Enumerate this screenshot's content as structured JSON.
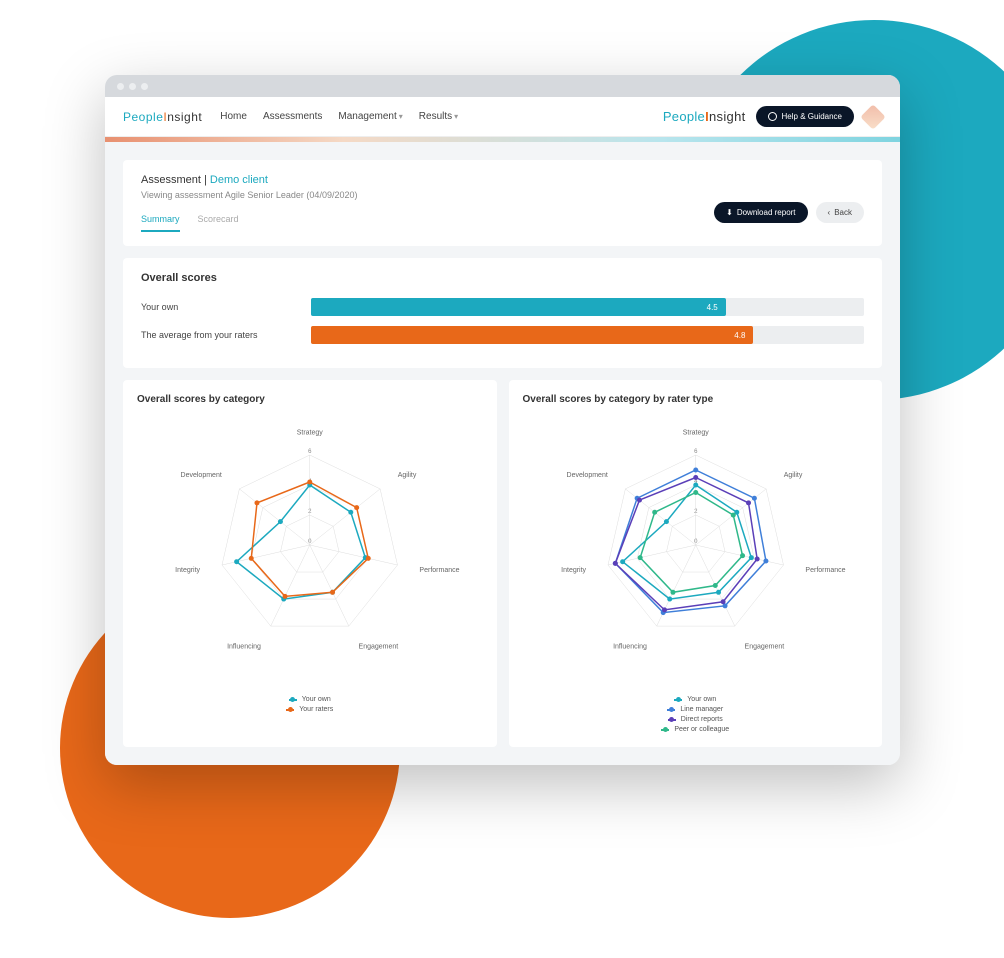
{
  "nav": {
    "home": "Home",
    "assessments": "Assessments",
    "management": "Management",
    "results": "Results"
  },
  "help_button": "Help & Guidance",
  "page": {
    "title_prefix": "Assessment |",
    "client": "Demo client",
    "subtitle": "Viewing assessment Agile Senior Leader (04/09/2020)"
  },
  "tabs": {
    "summary": "Summary",
    "scorecard": "Scorecard"
  },
  "actions": {
    "download": "Download report",
    "back": "Back"
  },
  "overall": {
    "title": "Overall scores",
    "own_label": "Your own",
    "raters_label": "The average from your raters",
    "own_value": "4.5",
    "raters_value": "4.8"
  },
  "chart1": {
    "title": "Overall scores by category",
    "legend_own": "Your own",
    "legend_raters": "Your raters"
  },
  "chart2": {
    "title": "Overall scores by category by rater type",
    "legend_own": "Your own",
    "legend_line": "Line manager",
    "legend_direct": "Direct reports",
    "legend_peer": "Peer or colleague"
  },
  "categories": [
    "Strategy",
    "Agility",
    "Performance",
    "Engagement",
    "Influencing",
    "Integrity",
    "Development"
  ],
  "ticks": [
    "0",
    "2",
    "4",
    "6"
  ],
  "colors": {
    "teal": "#1ca9bf",
    "orange": "#e86819",
    "blue": "#3f7fd9",
    "purple": "#5b3fb8",
    "green": "#2fb88a"
  },
  "chart_data": [
    {
      "type": "bar",
      "title": "Overall scores",
      "categories": [
        "Your own",
        "The average from your raters"
      ],
      "values": [
        4.5,
        4.8
      ],
      "xlim": [
        0,
        6
      ]
    },
    {
      "type": "radar",
      "title": "Overall scores by category",
      "categories": [
        "Strategy",
        "Agility",
        "Performance",
        "Engagement",
        "Influencing",
        "Integrity",
        "Development"
      ],
      "series": [
        {
          "name": "Your own",
          "color": "#1ca9bf",
          "values": [
            4.0,
            3.5,
            3.8,
            3.5,
            4.0,
            5.0,
            2.5
          ]
        },
        {
          "name": "Your raters",
          "color": "#e86819",
          "values": [
            4.2,
            4.0,
            4.0,
            3.5,
            3.8,
            4.0,
            4.5
          ]
        }
      ],
      "rlim": [
        0,
        6
      ],
      "ticks": [
        0,
        2,
        4,
        6
      ]
    },
    {
      "type": "radar",
      "title": "Overall scores by category by rater type",
      "categories": [
        "Strategy",
        "Agility",
        "Performance",
        "Engagement",
        "Influencing",
        "Integrity",
        "Development"
      ],
      "series": [
        {
          "name": "Your own",
          "color": "#1ca9bf",
          "values": [
            4.0,
            3.5,
            3.8,
            3.5,
            4.0,
            5.0,
            2.5
          ]
        },
        {
          "name": "Line manager",
          "color": "#3f7fd9",
          "values": [
            5.0,
            5.0,
            4.8,
            4.5,
            5.0,
            5.5,
            5.0
          ]
        },
        {
          "name": "Direct reports",
          "color": "#5b3fb8",
          "values": [
            4.5,
            4.5,
            4.2,
            4.2,
            4.8,
            5.5,
            4.8
          ]
        },
        {
          "name": "Peer or colleague",
          "color": "#2fb88a",
          "values": [
            3.5,
            3.2,
            3.2,
            3.0,
            3.5,
            3.8,
            3.5
          ]
        }
      ],
      "rlim": [
        0,
        6
      ],
      "ticks": [
        0,
        2,
        4,
        6
      ]
    }
  ]
}
